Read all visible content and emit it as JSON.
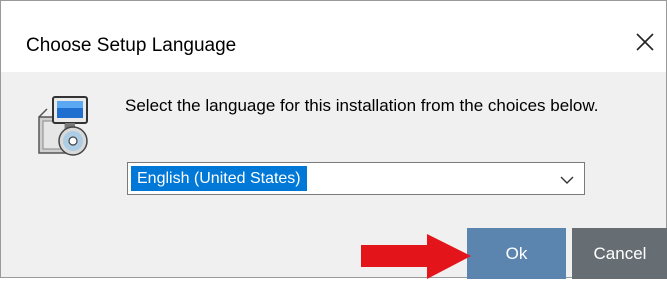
{
  "dialog": {
    "title": "Choose Setup Language",
    "close_icon": "close-icon",
    "app_icon": "installer-icon",
    "prompt": "Select the language for this installation from the choices below.",
    "language_select": {
      "selected": "English (United States)",
      "chevron_icon": "chevron-down-icon"
    },
    "buttons": {
      "ok": "Ok",
      "cancel": "Cancel"
    },
    "annotation": {
      "icon": "arrow-right-icon",
      "color": "#e3151a"
    }
  },
  "colors": {
    "select_highlight": "#0078d7",
    "ok_button": "#5b84ae",
    "cancel_button": "#666e74"
  }
}
